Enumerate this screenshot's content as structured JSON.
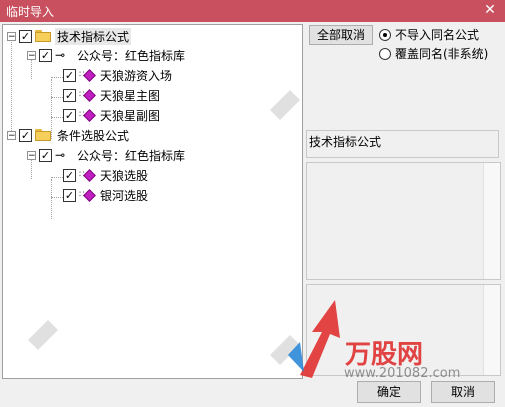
{
  "window": {
    "title": "临时导入",
    "close_glyph": "✕"
  },
  "tree": {
    "groups": [
      {
        "label": "技术指标公式",
        "expander": "−",
        "checked": true,
        "author": {
          "label": "公众号：红色指标库",
          "expander": "−",
          "checked": true
        },
        "items": [
          "天狼游资入场",
          "天狼星主图",
          "天狼星副图"
        ]
      },
      {
        "label": "条件选股公式",
        "expander": "−",
        "checked": true,
        "author": {
          "label": "公众号：红色指标库",
          "expander": "−",
          "checked": true
        },
        "items": [
          "天狼选股",
          "银河选股"
        ]
      }
    ]
  },
  "controls": {
    "uncheck_all": "全部取消",
    "radio_skip": "不导入同名公式",
    "radio_overwrite": "覆盖同名(非系统)",
    "selected_radio": "radio_skip",
    "info_label": "技术指标公式",
    "ok": "确定",
    "cancel": "取消"
  },
  "watermark": {
    "brand": "万股网",
    "url": "www.201082.com"
  },
  "colors": {
    "titlebar": "#c8505f",
    "gem": "#c020c0",
    "watermark_red": "#e03030"
  }
}
